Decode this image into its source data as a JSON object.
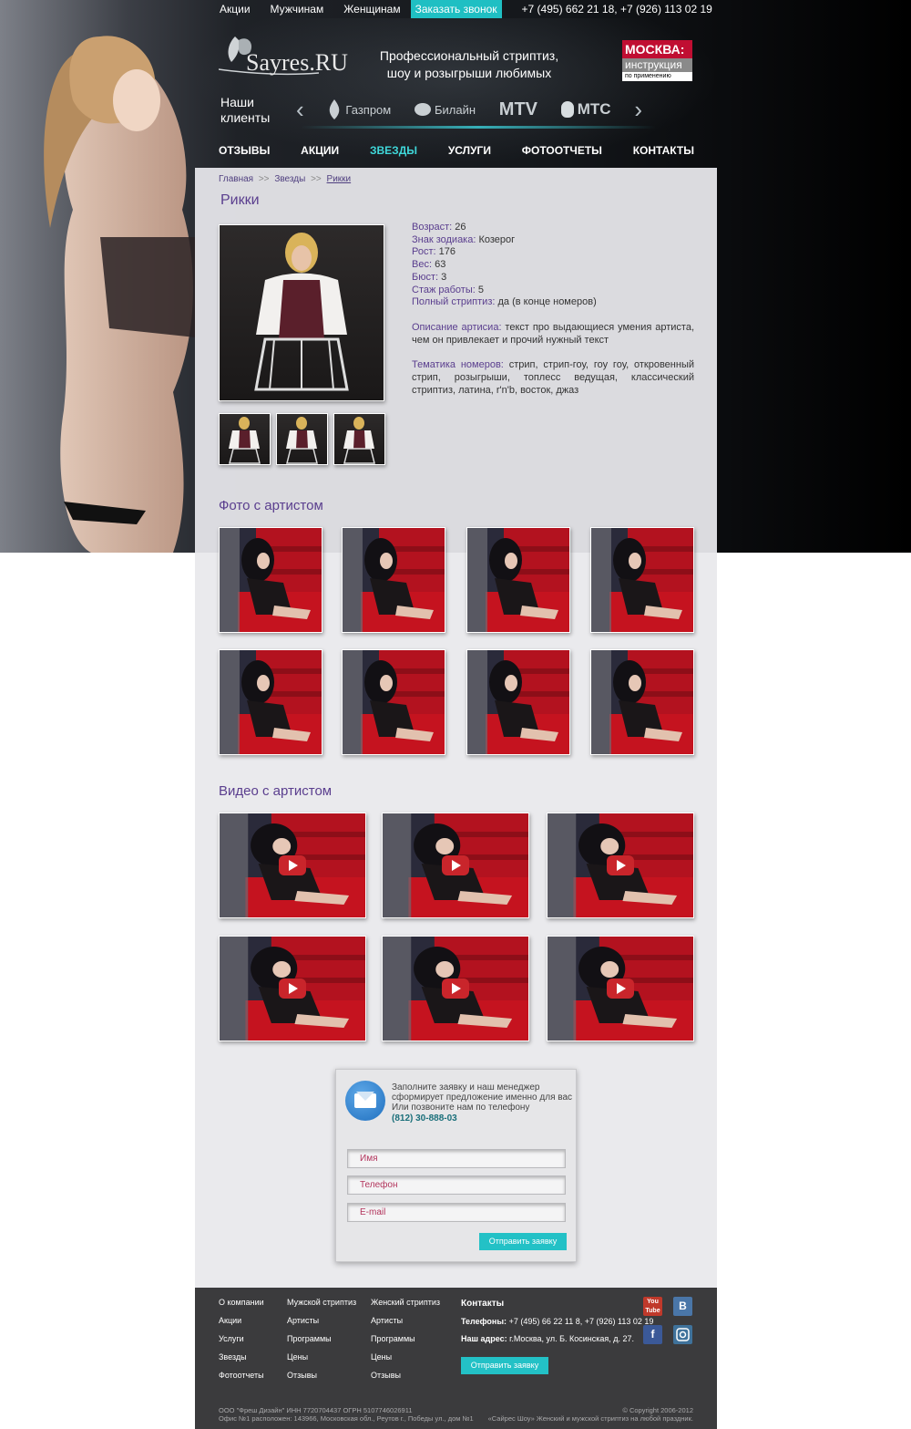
{
  "topbar": {
    "links": [
      "Акции",
      "Мужчинам",
      "Женщинам"
    ],
    "callback": "Заказать звонок",
    "phones": "+7 (495) 662 21 18, +7 (926) 113 02 19"
  },
  "header": {
    "logo_text": "Sayres.RU",
    "tagline": "Профессиональный стриптиз, шоу и розыгрыши любимых",
    "moscow_badge": {
      "line1": "МОСКВА:",
      "line2": "инструкция",
      "line3": "по применению"
    }
  },
  "clients": {
    "label": "Наши клиенты",
    "logos": [
      "Газпром",
      "Билайн",
      "MTV",
      "МТС"
    ]
  },
  "nav": {
    "items": [
      "ОТЗЫВЫ",
      "АКЦИИ",
      "ЗВЕЗДЫ",
      "УСЛУГИ",
      "ФОТООТЧЕТЫ",
      "КОНТАКТЫ"
    ],
    "active": "ЗВЕЗДЫ"
  },
  "breadcrumb": {
    "items": [
      "Главная",
      "Звезды",
      "Рикки"
    ],
    "separator": ">>"
  },
  "artist": {
    "name": "Рикки",
    "fields": [
      {
        "label": "Возраст:",
        "value": "26"
      },
      {
        "label": "Знак зодиака:",
        "value": "Козерог"
      },
      {
        "label": "Рост:",
        "value": "176"
      },
      {
        "label": "Вес:",
        "value": "63"
      },
      {
        "label": "Бюст:",
        "value": "3"
      },
      {
        "label": "Стаж работы:",
        "value": "5"
      },
      {
        "label": "Полный стриптиз:",
        "value": "да (в конце номеров)"
      }
    ],
    "description_label": "Описание артисиа:",
    "description": "текст про выдающиеся умения артиста, чем он привлекает и прочий нужный текст",
    "themes_label": "Тематика номеров:",
    "themes": "стрип, стрип-гоу, гоу гоу, откровенный стрип, розыгрыши, топлесс ведущая, классический стриптиз, латина, r'n'b, восток, джаз"
  },
  "sections": {
    "photos_title": "Фото с артистом",
    "videos_title": "Видео с артистом"
  },
  "form": {
    "text": "Заполните заявку и наш менеджер сформирует предложение именно для вас Или позвоните нам по телефону",
    "phone": "(812) 30-888-03",
    "name_placeholder": "Имя",
    "phone_placeholder": "Телефон",
    "email_placeholder": "E-mail",
    "submit": "Отправить заявку"
  },
  "footer": {
    "col1": [
      "О компании",
      "Акции",
      "Услуги",
      "Звезды",
      "Фотоотчеты"
    ],
    "col2": [
      "Мужской стриптиз",
      "Артисты",
      "Программы",
      "Цены",
      "Отзывы"
    ],
    "col3": [
      "Женский стриптиз",
      "Артисты",
      "Программы",
      "Цены",
      "Отзывы"
    ],
    "contacts_title": "Контакты",
    "phones_label": "Телефоны:",
    "phones": "+7 (495) 66 22 11 8, +7 (926) 113 02 19",
    "address_label": "Наш адрес:",
    "address": "г.Москва, ул. Б. Косинская, д. 27.",
    "submit": "Отправить заявку",
    "company": "ООО \"Фреш Дизайн\" ИНН 7720704437 ОГРН 5107746026911",
    "office": "Офис №1 расположен: 143966, Московская обл., Реутов г., Победы ул., дом №1",
    "copyright": "© Copyright 2006-2012",
    "slogan": "«Сайрес Шоу» Женский и мужской стриптиз на любой праздник."
  },
  "colors": {
    "accent": "#23c1c6",
    "purple": "#5a3e8e",
    "footer": "#3b3b3d"
  },
  "icons": [
    "youtube-icon",
    "vk-icon",
    "facebook-icon",
    "instagram-icon",
    "mail-icon",
    "play-icon"
  ]
}
